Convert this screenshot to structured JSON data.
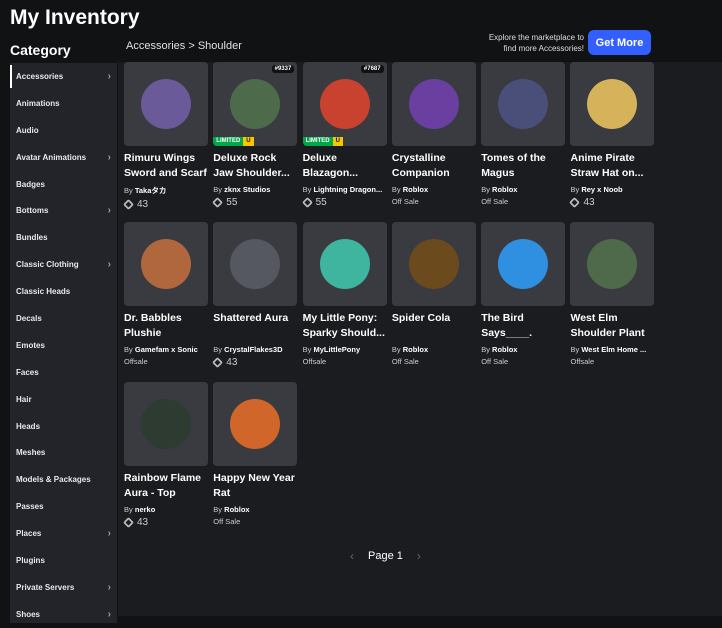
{
  "header": {
    "title": "My Inventory",
    "category_label": "Category",
    "breadcrumb": [
      "Accessories",
      "Shoulder"
    ],
    "promo": "Explore the marketplace to find more Accessories!",
    "get_more": "Get More"
  },
  "sidebar": {
    "items": [
      {
        "label": "Accessories",
        "chevron": true,
        "active": true
      },
      {
        "label": "Animations"
      },
      {
        "label": "Audio"
      },
      {
        "label": "Avatar Animations",
        "chevron": true
      },
      {
        "label": "Badges"
      },
      {
        "label": "Bottoms",
        "chevron": true
      },
      {
        "label": "Bundles"
      },
      {
        "label": "Classic Clothing",
        "chevron": true
      },
      {
        "label": "Classic Heads"
      },
      {
        "label": "Decals"
      },
      {
        "label": "Emotes"
      },
      {
        "label": "Faces"
      },
      {
        "label": "Hair"
      },
      {
        "label": "Heads"
      },
      {
        "label": "Meshes"
      },
      {
        "label": "Models & Packages"
      },
      {
        "label": "Passes"
      },
      {
        "label": "Places",
        "chevron": true
      },
      {
        "label": "Plugins"
      },
      {
        "label": "Private Servers",
        "chevron": true
      },
      {
        "label": "Shoes",
        "chevron": true
      }
    ]
  },
  "items": [
    {
      "title": "Rimuru Wings Sword and Scarf",
      "creator": "Takaタカ",
      "price": "43",
      "color": "#6a5a9a"
    },
    {
      "title": "Deluxe Rock Jaw Shoulder...",
      "creator": "zknx Studios",
      "price": "55",
      "serial": "#9337",
      "limited": "LIMITED",
      "limited_u": "U",
      "color": "#4d6b4a"
    },
    {
      "title": "Deluxe Blazagon...",
      "creator": "Lightning Dragon...",
      "price": "55",
      "serial": "#7687",
      "limited": "LIMITED",
      "limited_u": "U",
      "color": "#c9412f"
    },
    {
      "title": "Crystalline Companion",
      "creator": "Roblox",
      "status": "Off Sale",
      "color": "#6a3fa0"
    },
    {
      "title": "Tomes of the Magus",
      "creator": "Roblox",
      "status": "Off Sale",
      "color": "#4a4f7a"
    },
    {
      "title": "Anime Pirate Straw Hat on...",
      "creator": "Rey x Noob",
      "price": "43",
      "color": "#d6b25a"
    },
    {
      "title": "Dr. Babbles Plushie",
      "creator": "Gamefam x Sonic",
      "status": "Offsale",
      "color": "#b0673e"
    },
    {
      "title": "Shattered Aura",
      "creator": "CrystalFlakes3D",
      "price": "43",
      "color": "#555860"
    },
    {
      "title": "My Little Pony: Sparky Should...",
      "creator": "MyLittlePony",
      "status": "Offsale",
      "color": "#3fb5a0"
    },
    {
      "title": "Spider Cola",
      "creator": "Roblox",
      "status": "Off Sale",
      "color": "#6b4b1e"
    },
    {
      "title": "The Bird Says____.",
      "creator": "Roblox",
      "status": "Off Sale",
      "color": "#2f8fe0"
    },
    {
      "title": "West Elm Shoulder Plant",
      "creator": "West Elm Home ...",
      "status": "Offsale",
      "color": "#4f6a4a"
    },
    {
      "title": "Rainbow Flame Aura - Top",
      "creator": "nerko",
      "price": "43",
      "color": "#2e3b30"
    },
    {
      "title": "Happy New Year Rat",
      "creator": "Roblox",
      "status": "Off Sale",
      "color": "#d0662a"
    }
  ],
  "by_label": "By",
  "pager": {
    "label": "Page 1"
  }
}
